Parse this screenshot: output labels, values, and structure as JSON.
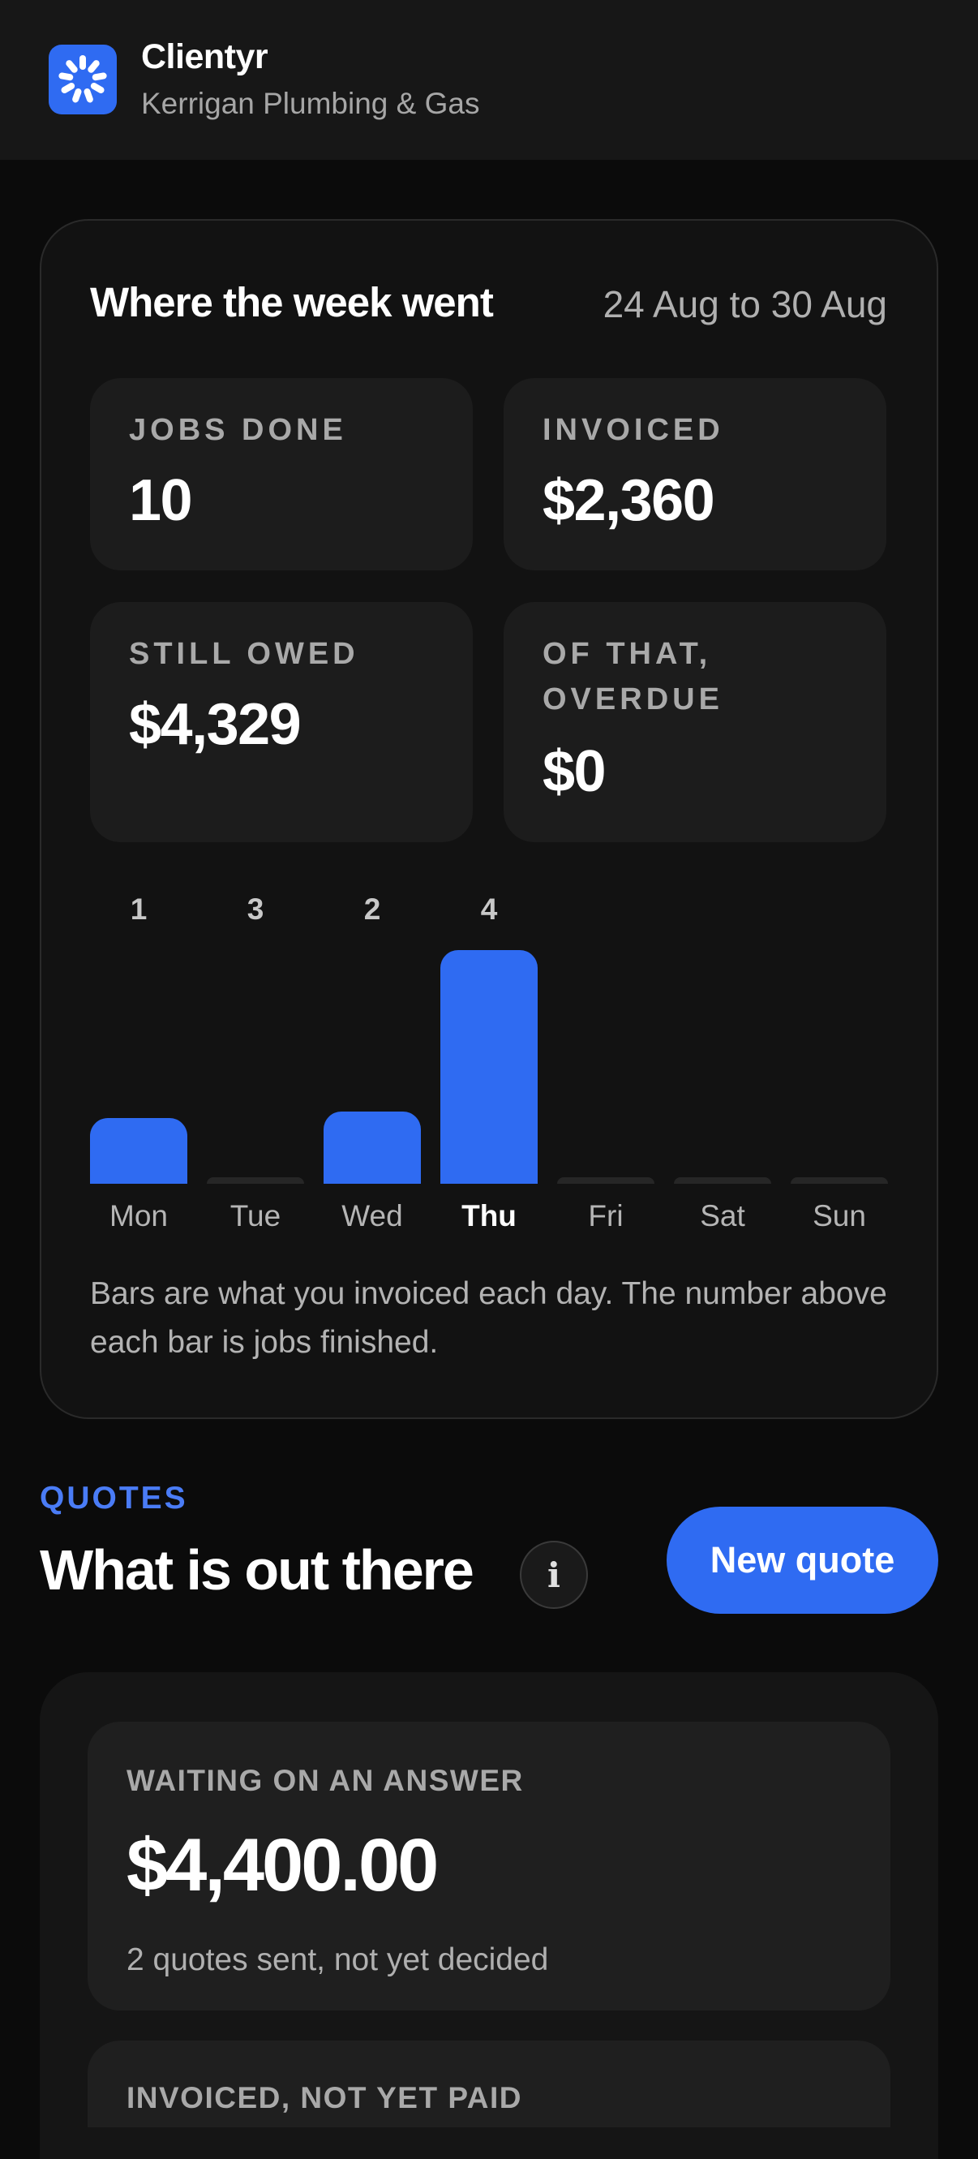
{
  "header": {
    "app_name": "Clientyr",
    "business_name": "Kerrigan Plumbing & Gas",
    "logo_icon": "burst-logo-icon",
    "brand_color": "#2f6bf2"
  },
  "week": {
    "title": "Where the week went",
    "date_range": "24 Aug to 30 Aug",
    "stats": [
      {
        "label": "JOBS DONE",
        "value": "10"
      },
      {
        "label": "INVOICED",
        "value": "$2,360"
      },
      {
        "label": "STILL OWED",
        "value": "$4,329"
      },
      {
        "label": "OF THAT, OVERDUE",
        "value": "$0"
      }
    ],
    "caption": "Bars are what you invoiced each day. The number above each bar is jobs finished."
  },
  "chart_data": {
    "type": "bar",
    "categories": [
      "Mon",
      "Tue",
      "Wed",
      "Thu",
      "Fri",
      "Sat",
      "Sun"
    ],
    "values": [
      280,
      0,
      310,
      1000,
      0,
      0,
      0
    ],
    "value_note_labels": [
      "1",
      "3",
      "2",
      "4",
      "",
      "",
      ""
    ],
    "highlighted_category": "Thu",
    "title": "",
    "xlabel": "",
    "ylabel": "",
    "ylim": [
      0,
      1000
    ],
    "grid": false,
    "bar_color": "#2f6bf2",
    "empty_color": "#262626"
  },
  "quotes": {
    "kicker": "QUOTES",
    "title": "What is out there",
    "info_label": "i",
    "new_quote_label": "New quote",
    "tiles": [
      {
        "label": "WAITING ON AN ANSWER",
        "amount": "$4,400.00",
        "sub": "2 quotes sent, not yet decided"
      },
      {
        "label": "INVOICED, NOT YET PAID",
        "amount": "",
        "sub": ""
      }
    ]
  }
}
